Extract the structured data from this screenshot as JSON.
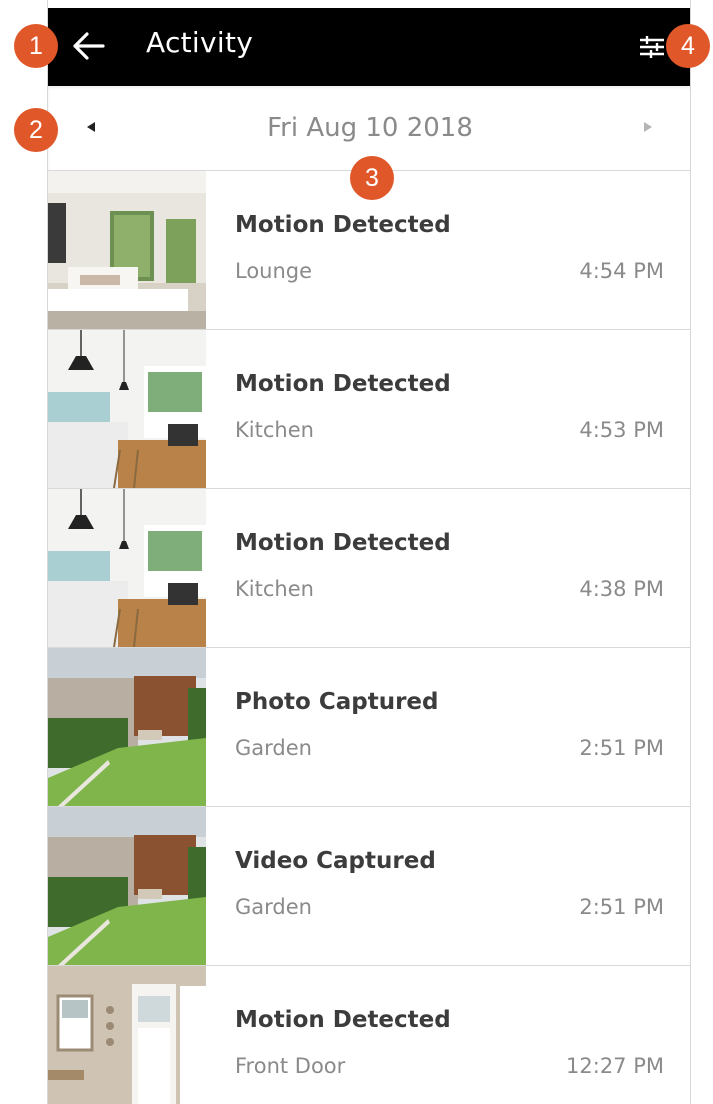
{
  "header": {
    "title": "Activity",
    "back_icon": "arrow-left-icon",
    "filter_icon": "sliders-icon"
  },
  "date_nav": {
    "date": "Fri Aug 10 2018",
    "prev_icon": "triangle-left-icon",
    "next_icon": "triangle-right-icon"
  },
  "events": [
    {
      "title": "Motion Detected",
      "location": "Lounge",
      "time": "4:54 PM",
      "thumb": "lounge"
    },
    {
      "title": "Motion Detected",
      "location": "Kitchen",
      "time": "4:53 PM",
      "thumb": "kitchen"
    },
    {
      "title": "Motion Detected",
      "location": "Kitchen",
      "time": "4:38 PM",
      "thumb": "kitchen"
    },
    {
      "title": "Photo Captured",
      "location": "Garden",
      "time": "2:51 PM",
      "thumb": "garden"
    },
    {
      "title": "Video Captured",
      "location": "Garden",
      "time": "2:51 PM",
      "thumb": "garden"
    },
    {
      "title": "Motion Detected",
      "location": "Front Door",
      "time": "12:27 PM",
      "thumb": "frontdoor"
    }
  ],
  "callouts": [
    "1",
    "2",
    "3",
    "4"
  ],
  "colors": {
    "accent": "#e0582a",
    "header_bg": "#000000"
  }
}
